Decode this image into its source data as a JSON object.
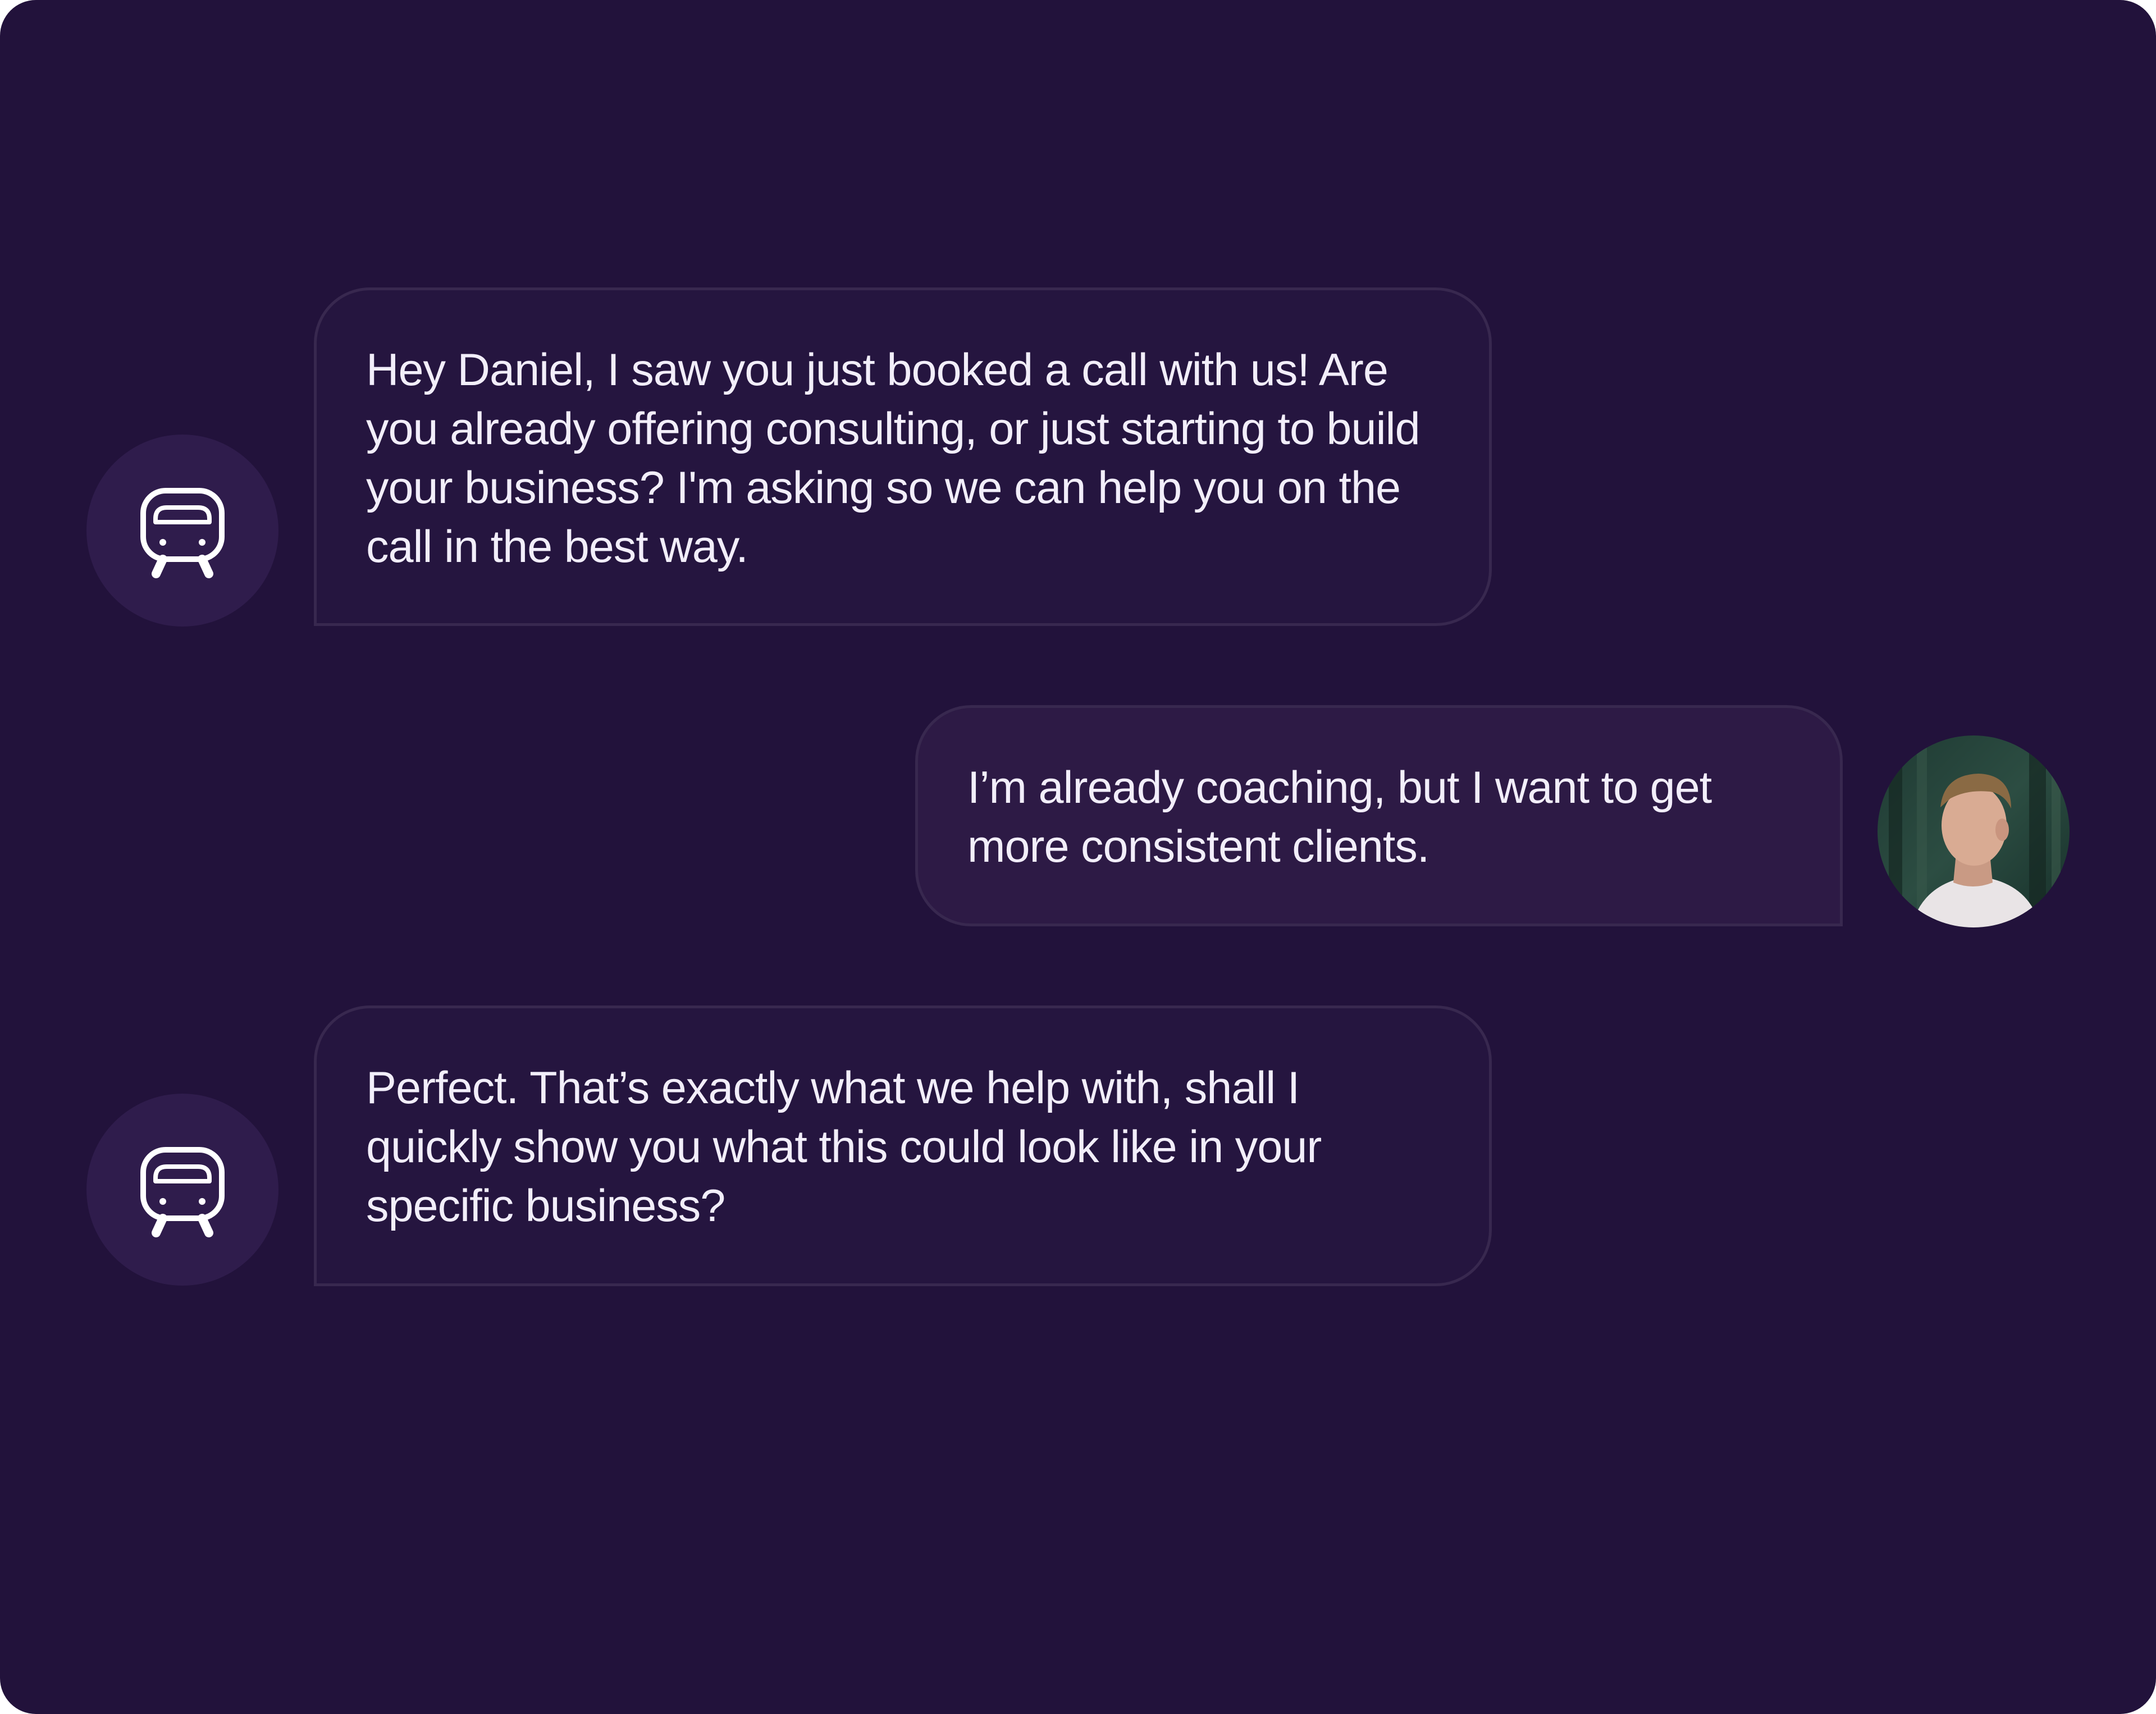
{
  "chat": {
    "messages": [
      {
        "sender": "bot",
        "avatar_icon": "robot-icon",
        "text": "Hey Daniel, I saw you just booked a call with us! Are you already offering consulting, or just starting to build your business? I'm asking so we can help you on the call in the best way."
      },
      {
        "sender": "user",
        "avatar_icon": "user-photo",
        "text": "I’m already coaching, but I want to get more consistent clients."
      },
      {
        "sender": "bot",
        "avatar_icon": "robot-icon",
        "text": "Perfect. That’s exactly what we help with, shall I quickly show you what this could look like in your specific business?"
      }
    ]
  },
  "colors": {
    "background": "#22123b",
    "bot_bubble": "#25153f",
    "user_bubble": "#2d1a45",
    "bubble_border": "#38284f",
    "avatar_circle": "#2f1c4c",
    "text": "#f2eefa"
  }
}
